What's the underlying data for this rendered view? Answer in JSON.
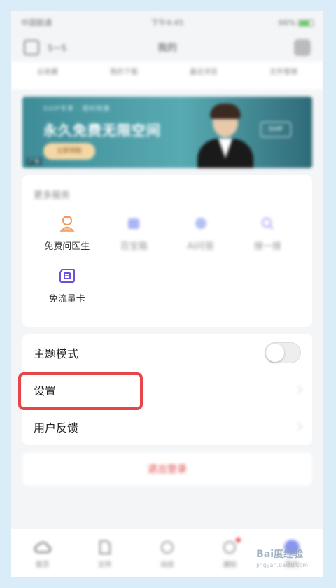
{
  "status_bar": {
    "carrier": "中国联通",
    "time": "下午4:45",
    "battery": "66%"
  },
  "nav_bar": {
    "left_label": "5一5",
    "title": "我的"
  },
  "quick_links": [
    "云收藏",
    "我的下载",
    "最近浏览",
    "文件管理"
  ],
  "banner": {
    "kicker": "SVIP专享 · 限时特惠",
    "headline": "永久免费无限空间",
    "button": "立即领取",
    "badge": "SVIP",
    "tag": "广告"
  },
  "more_services": {
    "title": "更多服务",
    "items": [
      {
        "label": "免费问医生",
        "icon": "doctor-icon",
        "color": "#f29a5c",
        "active": true
      },
      {
        "label": "百宝箱",
        "icon": "box-icon",
        "color": "#6e7ff0",
        "active": false
      },
      {
        "label": "AI问答",
        "icon": "chat-icon",
        "color": "#7a8ef2",
        "active": false
      },
      {
        "label": "搜一搜",
        "icon": "search-icon",
        "color": "#9b86f2",
        "active": false
      },
      {
        "label": "免流量卡",
        "icon": "sim-card-icon",
        "color": "#6a4fe0",
        "active": true
      }
    ]
  },
  "settings": {
    "theme_label": "主题模式",
    "settings_label": "设置",
    "feedback_label": "用户反馈",
    "theme_dark_enabled": false
  },
  "logout": {
    "label": "退出登录"
  },
  "tab_bar": [
    {
      "label": "首页",
      "icon": "cloud-icon"
    },
    {
      "label": "文件",
      "icon": "file-icon"
    },
    {
      "label": "动态",
      "icon": "circle-icon"
    },
    {
      "label": "通知",
      "icon": "bell-icon"
    },
    {
      "label": "我的",
      "icon": "user-icon"
    }
  ],
  "watermark": {
    "text": "Bai度经验",
    "sub": "jingyan.baidu.com"
  },
  "colors": {
    "accent_red": "#e6454a",
    "background": "#d9ecf8"
  }
}
